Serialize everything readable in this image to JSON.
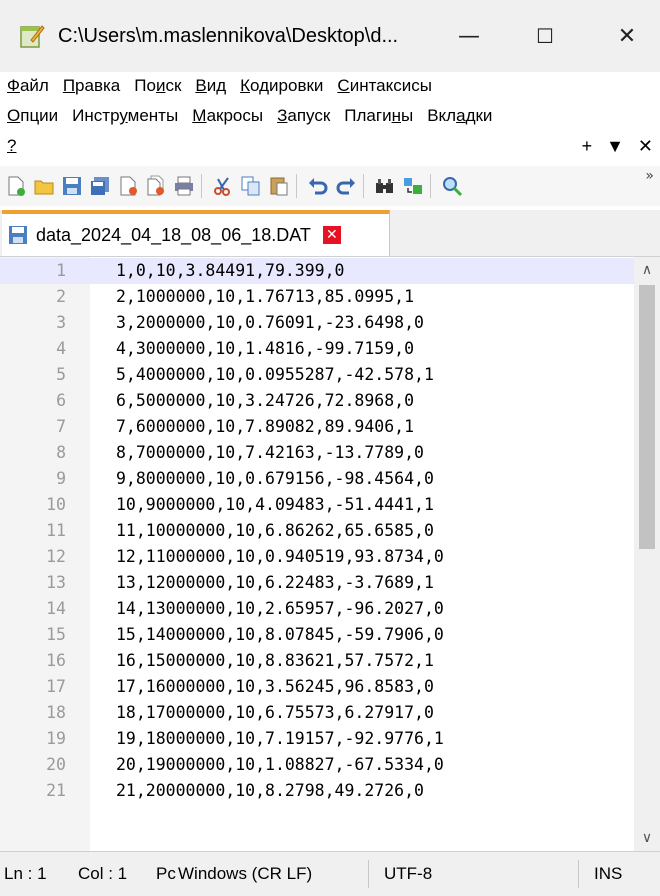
{
  "window": {
    "title": "C:\\Users\\m.maslennikova\\Desktop\\d...",
    "minimize": "—",
    "maximize": "☐",
    "close": "✕"
  },
  "menu": {
    "row1": [
      {
        "pre": "",
        "u": "Ф",
        "post": "айл"
      },
      {
        "pre": "",
        "u": "П",
        "post": "равка"
      },
      {
        "pre": "По",
        "u": "и",
        "post": "ск"
      },
      {
        "pre": "",
        "u": "В",
        "post": "ид"
      },
      {
        "pre": "",
        "u": "К",
        "post": "одировки"
      },
      {
        "pre": "",
        "u": "С",
        "post": "интаксисы"
      }
    ],
    "row2": [
      {
        "pre": "",
        "u": "О",
        "post": "пции"
      },
      {
        "pre": "Инстр",
        "u": "у",
        "post": "менты"
      },
      {
        "pre": "",
        "u": "М",
        "post": "акросы"
      },
      {
        "pre": "",
        "u": "З",
        "post": "апуск"
      },
      {
        "pre": "Плаги",
        "u": "н",
        "post": "ы"
      },
      {
        "pre": "Вкл",
        "u": "а",
        "post": "дки"
      }
    ],
    "row3": {
      "help": "?",
      "plus": "+",
      "down": "▼",
      "close": "✕"
    }
  },
  "toolbar": {
    "more": "»",
    "icons": [
      "new-file-icon",
      "open-file-icon",
      "save-icon",
      "save-all-icon",
      "close-icon",
      "close-all-icon",
      "print-icon",
      "cut-icon",
      "copy-icon",
      "paste-icon",
      "undo-icon",
      "redo-icon",
      "find-icon",
      "replace-icon",
      "zoom-icon"
    ]
  },
  "tab": {
    "label": "data_2024_04_18_08_06_18.DAT",
    "close": "✕"
  },
  "editor": {
    "current_line": 1,
    "lines": [
      "1,0,10,3.84491,79.399,0",
      "2,1000000,10,1.76713,85.0995,1",
      "3,2000000,10,0.76091,-23.6498,0",
      "4,3000000,10,1.4816,-99.7159,0",
      "5,4000000,10,0.0955287,-42.578,1",
      "6,5000000,10,3.24726,72.8968,0",
      "7,6000000,10,7.89082,89.9406,1",
      "8,7000000,10,7.42163,-13.7789,0",
      "9,8000000,10,0.679156,-98.4564,0",
      "10,9000000,10,4.09483,-51.4441,1",
      "11,10000000,10,6.86262,65.6585,0",
      "12,11000000,10,0.940519,93.8734,0",
      "13,12000000,10,6.22483,-3.7689,1",
      "14,13000000,10,2.65957,-96.2027,0",
      "15,14000000,10,8.07845,-59.7906,0",
      "16,15000000,10,8.83621,57.7572,1",
      "17,16000000,10,3.56245,96.8583,0",
      "18,17000000,10,6.75573,6.27917,0",
      "19,18000000,10,7.19157,-92.9776,1",
      "20,19000000,10,1.08827,-67.5334,0",
      "21,20000000,10,8.2798,49.2726,0"
    ],
    "scroll_up": "∧",
    "scroll_down": "∨"
  },
  "status": {
    "ln": "Ln : 1",
    "col": "Col : 1",
    "pos": "Pc",
    "eol": "Windows (CR LF)",
    "encoding": "UTF-8",
    "mode": "INS"
  }
}
